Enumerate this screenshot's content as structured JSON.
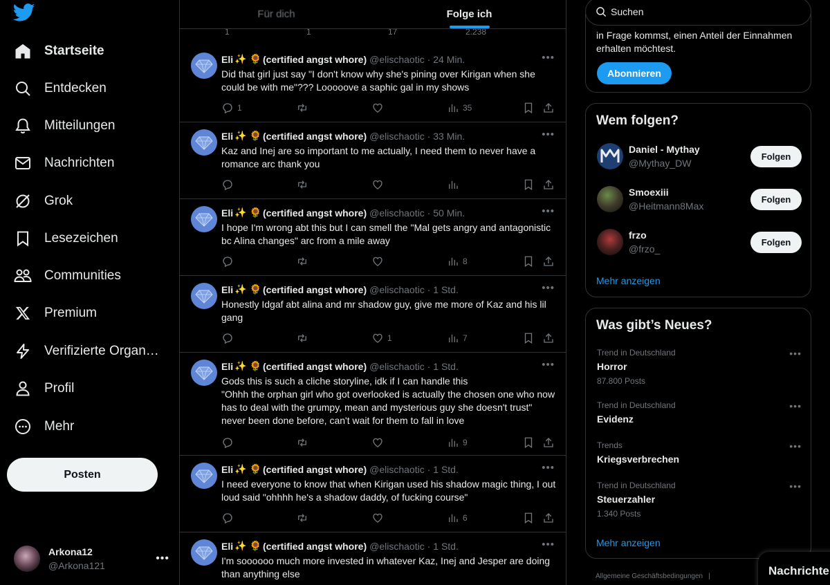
{
  "nav": {
    "items": [
      {
        "label": "Startseite",
        "icon": "home-icon"
      },
      {
        "label": "Entdecken",
        "icon": "search-icon"
      },
      {
        "label": "Mitteilungen",
        "icon": "bell-icon"
      },
      {
        "label": "Nachrichten",
        "icon": "mail-icon"
      },
      {
        "label": "Grok",
        "icon": "grok-icon"
      },
      {
        "label": "Lesezeichen",
        "icon": "bookmark-icon"
      },
      {
        "label": "Communities",
        "icon": "communities-icon"
      },
      {
        "label": "Premium",
        "icon": "x-icon"
      },
      {
        "label": "Verifizierte Organ…",
        "icon": "bolt-icon"
      },
      {
        "label": "Profil",
        "icon": "person-icon"
      },
      {
        "label": "Mehr",
        "icon": "more-circle-icon"
      }
    ],
    "post_label": "Posten"
  },
  "account": {
    "display_name": "Arkona12",
    "handle": "@Arkona121",
    "more": "•••"
  },
  "tabs": {
    "for_you": "Für dich",
    "following": "Folge ich"
  },
  "prev_tweet": {
    "replies": "1",
    "retweets": "1",
    "likes": "17",
    "views": "2.238"
  },
  "tweets": [
    {
      "name": "Eli",
      "tail": "(certified angst whore)",
      "handle": "@elischaotic",
      "time": "· 24 Min.",
      "text": "Did that girl just say \"I don't know why she's pining over Kirigan when she could be with me\"??? Looooove a saphic gal in my shows",
      "replies": "1",
      "retweets": "",
      "likes": "",
      "views": "35"
    },
    {
      "name": "Eli",
      "tail": "(certified angst whore)",
      "handle": "@elischaotic",
      "time": "· 33 Min.",
      "text": "Kaz and Inej are so important to me actually, I need them to never have a romance arc thank you",
      "replies": "",
      "retweets": "",
      "likes": "",
      "views": ""
    },
    {
      "name": "Eli",
      "tail": "(certified angst whore)",
      "handle": "@elischaotic",
      "time": "· 50 Min.",
      "text": "I hope I'm wrong abt this but I can smell the \"Mal gets angry and antagonistic bc Alina changes\" arc from a mile away",
      "replies": "",
      "retweets": "",
      "likes": "",
      "views": "8"
    },
    {
      "name": "Eli",
      "tail": "(certified angst whore)",
      "handle": "@elischaotic",
      "time": "· 1 Std.",
      "text": "Honestly Idgaf abt alina and mr shadow guy, give me more of Kaz and his lil gang",
      "replies": "",
      "retweets": "",
      "likes": "1",
      "views": "7"
    },
    {
      "name": "Eli",
      "tail": "(certified angst whore)",
      "handle": "@elischaotic",
      "time": "· 1 Std.",
      "text": "Gods this is such a cliche storyline, idk if I can handle this\n\"Ohhh the orphan girl who got overlooked is actually the chosen one who now has to deal with the grumpy, mean and mysterious guy she doesn't trust\" never been done before, can't wait for them to fall in love",
      "replies": "",
      "retweets": "",
      "likes": "",
      "views": "9"
    },
    {
      "name": "Eli",
      "tail": "(certified angst whore)",
      "handle": "@elischaotic",
      "time": "· 1 Std.",
      "text": "I need everyone to know that when Kirigan used his shadow magic thing, I out loud said \"ohhhh he's a shadow daddy, of fucking course\"",
      "replies": "",
      "retweets": "",
      "likes": "",
      "views": "6"
    },
    {
      "name": "Eli",
      "tail": "(certified angst whore)",
      "handle": "@elischaotic",
      "time": "· 1 Std.",
      "text": "I'm soooooo much more invested in whatever Kaz, Inej and Jesper are doing than anything else",
      "replies": "",
      "retweets": "",
      "likes": "",
      "views": ""
    }
  ],
  "search": {
    "placeholder": "Suchen"
  },
  "premium": {
    "text": "in Frage kommst, einen Anteil der Einnahmen erhalten möchtest.",
    "button": "Abonnieren"
  },
  "who_to_follow": {
    "title": "Wem folgen?",
    "users": [
      {
        "name": "Daniel - Mythay",
        "handle": "@Mythay_DW",
        "button": "Folgen"
      },
      {
        "name": "Smoexiii",
        "handle": "@Heitmann8Max",
        "button": "Folgen"
      },
      {
        "name": "frzo",
        "handle": "@frzo_",
        "button": "Folgen"
      }
    ],
    "more": "Mehr anzeigen"
  },
  "trends": {
    "title": "Was gibt’s Neues?",
    "items": [
      {
        "context": "Trend in Deutschland",
        "name": "Horror",
        "count": "87.800 Posts"
      },
      {
        "context": "Trend in Deutschland",
        "name": "Evidenz",
        "count": ""
      },
      {
        "context": "Trends",
        "name": "Kriegsverbrechen",
        "count": ""
      },
      {
        "context": "Trend in Deutschland",
        "name": "Steuerzahler",
        "count": "1.340 Posts"
      }
    ],
    "more": "Mehr anzeigen"
  },
  "footer": {
    "terms": "Allgemeine Geschäftsbedingungen",
    "sep": "|"
  },
  "messages_drawer": {
    "label": "Nachrichten"
  },
  "colors": {
    "accent": "#1d9bf0",
    "background": "#000000",
    "border": "#2f3336",
    "muted": "#71767b",
    "text": "#e7e9ea"
  }
}
